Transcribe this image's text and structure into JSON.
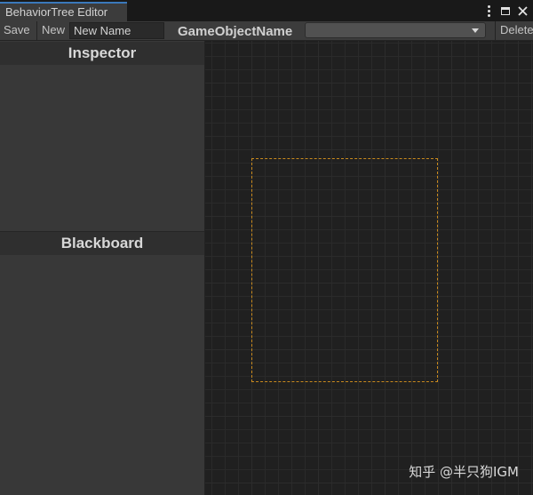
{
  "window": {
    "tab_title": "BehaviorTree Editor"
  },
  "toolbar": {
    "save_label": "Save",
    "new_label": "New",
    "name_input_value": "New Name",
    "gameobject_label": "GameObjectName",
    "gameobject_selected": "",
    "delete_label": "Delete"
  },
  "left_panel": {
    "inspector_title": "Inspector",
    "blackboard_title": "Blackboard"
  },
  "watermark": {
    "text": "知乎 @半只狗IGM"
  },
  "icons": {
    "menu": "kebab-menu-icon",
    "maximize": "maximize-icon",
    "close": "close-icon",
    "dropdown": "chevron-down-icon"
  },
  "colors": {
    "tab_accent": "#3a79bb",
    "selection_border": "#c98a1e",
    "graph_background": "#202020",
    "panel_background": "#383838"
  }
}
